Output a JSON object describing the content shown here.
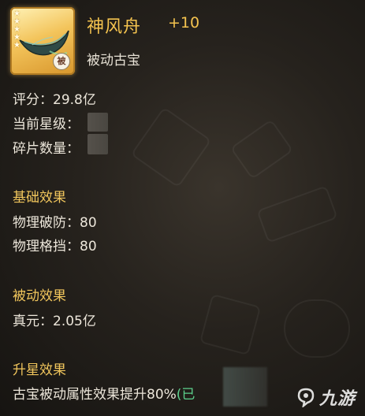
{
  "item": {
    "name": "神风舟",
    "enhance": "+10",
    "type": "被动古宝",
    "badge": "被",
    "icon": "boat-icon",
    "stars": 5
  },
  "stats": {
    "rating_label": "评分：",
    "rating_value": "29.8亿",
    "star_level_label": "当前星级：",
    "fragment_label": "碎片数量："
  },
  "base_effect": {
    "title": "基础效果",
    "lines": [
      {
        "label": "物理破防：",
        "value": "80"
      },
      {
        "label": "物理格挡：",
        "value": "80"
      }
    ]
  },
  "passive_effect": {
    "title": "被动效果",
    "lines": [
      {
        "label": "真元：",
        "value": "2.05亿"
      }
    ]
  },
  "star_effect": {
    "title": "升星效果",
    "text": "古宝被动属性效果提升80%",
    "tail": "(已"
  },
  "watermark": {
    "logo": "9game-logo-icon",
    "text": "九游"
  },
  "colors": {
    "title_gold": "#f4c34f",
    "section_gold": "#f0c55c",
    "body_text": "#ece6da",
    "status_green": "#5cd08c"
  }
}
